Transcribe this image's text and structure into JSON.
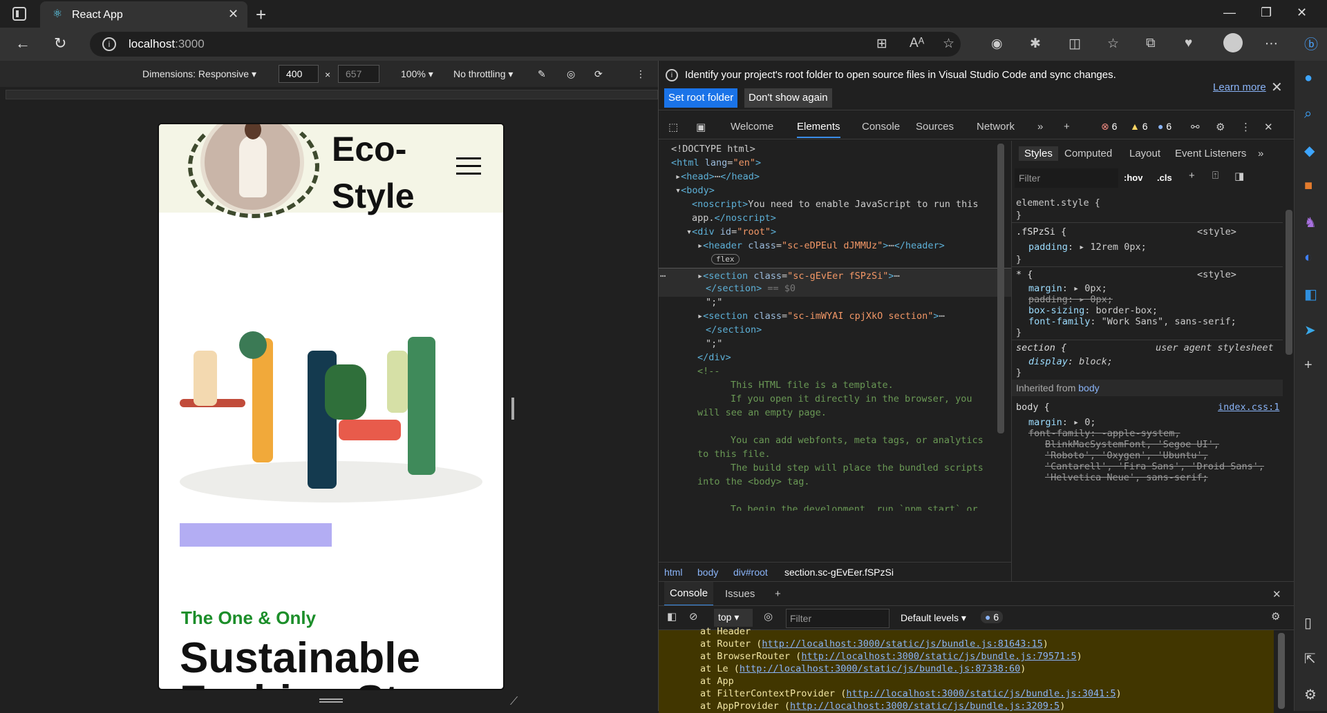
{
  "browser": {
    "tab_title": "React App",
    "url_host": "localhost",
    "url_port": ":3000"
  },
  "device_toolbar": {
    "dimensions_label": "Dimensions: Responsive",
    "width_value": "400",
    "height_placeholder": "657",
    "times": "×",
    "zoom": "100%",
    "throttling": "No throttling"
  },
  "site": {
    "brand_line1": "Eco-",
    "brand_line2": "Style",
    "eyebrow": "The One & Only",
    "title_line1": "Sustainable",
    "title_line2": "Fashion St"
  },
  "infobar": {
    "message": "Identify your project's root folder to open source files in Visual Studio Code and sync changes.",
    "set_root_button": "Set root folder",
    "dont_show_button": "Don't show again",
    "learn_more": "Learn more"
  },
  "devtools_tabs": [
    "Welcome",
    "Elements",
    "Console",
    "Sources",
    "Network"
  ],
  "counts": {
    "errors": "6",
    "warnings": "6",
    "info": "6"
  },
  "elements": {
    "doctype": "<!DOCTYPE html>",
    "noscript_text": "You need to enable JavaScript to run this",
    "noscript_text2": "app.",
    "comment_lines": [
      "This HTML file is a template.",
      "If you open it directly in the browser, you",
      "will see an empty page.",
      "You can add webfonts, meta tags, or analytics",
      "to this file.",
      "The build step will place the bundled scripts",
      "into the <body> tag.",
      "To begin the development, run `npm start` or"
    ],
    "flex_badge": "flex",
    "selected_marker": "== $0"
  },
  "breadcrumbs": [
    "html",
    "body",
    "div#root",
    "section.sc-gEvEer.fSPzSi"
  ],
  "styles": {
    "tabs": [
      "Styles",
      "Computed",
      "Layout",
      "Event Listeners"
    ],
    "filter_placeholder": "Filter",
    "hov": ":hov",
    "cls": ".cls",
    "element_style": "element.style {",
    "rule1_selector": ".fSPzSi {",
    "rule1_source": "<style>",
    "rule1_prop": "padding",
    "rule1_value": "12rem 0px;",
    "rule2_selector": "* {",
    "rule2_source": "<style>",
    "rule2_props": [
      {
        "name": "margin",
        "value": "0px;"
      },
      {
        "name": "padding",
        "value": "0px;"
      },
      {
        "name": "box-sizing",
        "value": "border-box;"
      },
      {
        "name": "font-family",
        "value": "\"Work Sans\", sans-serif;"
      }
    ],
    "rule3_selector": "section {",
    "rule3_source": "user agent stylesheet",
    "rule3_prop": "display",
    "rule3_value": "block;",
    "inherited_label": "Inherited from",
    "inherited_from": "body",
    "body_selector": "body {",
    "body_source": "index.css:1",
    "body_margin": "0;",
    "font_family_lines": [
      "-apple-system,",
      "BlinkMacSystemFont, 'Segoe UI',",
      "'Roboto', 'Oxygen', 'Ubuntu',",
      "'Cantarell', 'Fira Sans', 'Droid Sans',",
      "'Helvetica Neue', sans-serif;"
    ]
  },
  "console": {
    "tabs": [
      "Console",
      "Issues"
    ],
    "context": "top",
    "filter_placeholder": "Filter",
    "levels": "Default levels",
    "msg_count": "6",
    "log_lines": [
      {
        "text": "at Header",
        "link": ""
      },
      {
        "text": "at Router (",
        "link": "http://localhost:3000/static/js/bundle.js:81643:15",
        "tail": ")"
      },
      {
        "text": "at BrowserRouter (",
        "link": "http://localhost:3000/static/js/bundle.js:79571:5",
        "tail": ")"
      },
      {
        "text": "at Le (",
        "link": "http://localhost:3000/static/js/bundle.js:87338:60",
        "tail": ")"
      },
      {
        "text": "at App",
        "link": ""
      },
      {
        "text": "at FilterContextProvider (",
        "link": "http://localhost:3000/static/js/bundle.js:3041:5",
        "tail": ")"
      },
      {
        "text": "at AppProvider (",
        "link": "http://localhost:3000/static/js/bundle.js:3209:5",
        "tail": ")"
      }
    ],
    "prompt": ">"
  }
}
